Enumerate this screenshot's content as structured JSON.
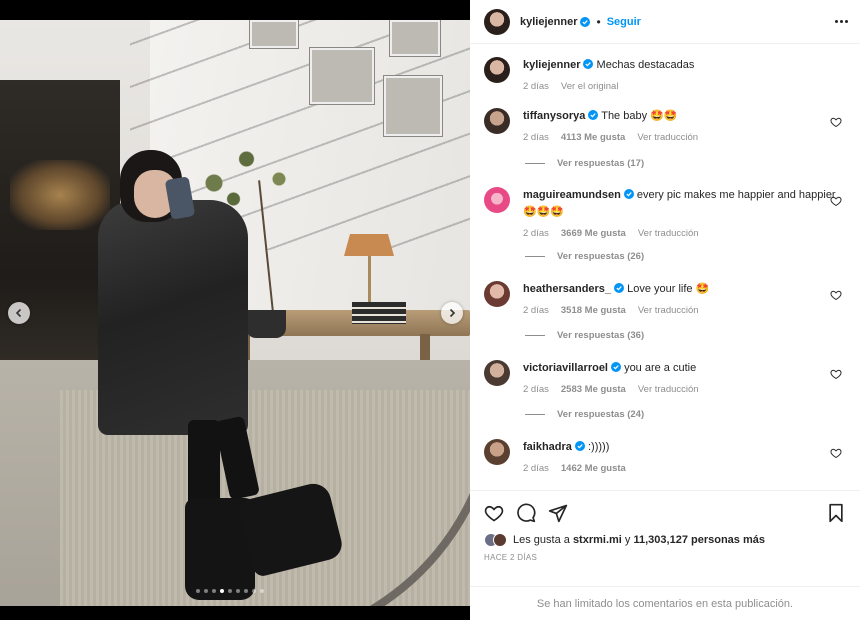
{
  "post": {
    "author": "kyliejenner",
    "follow_sep": "•",
    "follow_label": "Seguir",
    "caption": "Mechas destacadas",
    "caption_time": "2 días",
    "see_original": "Ver el original"
  },
  "carousel": {
    "total_slides": 9,
    "active_index": 3
  },
  "comments": [
    {
      "user": "tiffanysorya",
      "text": "The baby 🤩🤩",
      "time": "2 días",
      "likes": "4113 Me gusta",
      "translate": "Ver traducción",
      "replies": "Ver respuestas (17)"
    },
    {
      "user": "maguireamundsen",
      "text": "every pic makes me happier and happier",
      "text2": "🤩🤩🤩",
      "time": "2 días",
      "likes": "3669 Me gusta",
      "translate": "Ver traducción",
      "replies": "Ver respuestas (26)"
    },
    {
      "user": "heathersanders_",
      "text": "Love your life 🤩",
      "time": "2 días",
      "likes": "3518 Me gusta",
      "translate": "Ver traducción",
      "replies": "Ver respuestas (36)"
    },
    {
      "user": "victoriavillarroel",
      "text": "you are a cutie",
      "time": "2 días",
      "likes": "2583 Me gusta",
      "translate": "Ver traducción",
      "replies": "Ver respuestas (24)"
    },
    {
      "user": "faikhadra",
      "text": ":)))))",
      "time": "2 días",
      "likes": "1462 Me gusta"
    }
  ],
  "likes_bar": {
    "prefix": "Les gusta a",
    "user": "stxrmi.mi",
    "connector": "y",
    "count": "11,303,127 personas más"
  },
  "post_time": "HACE 2 DÍAS",
  "comments_limited": "Se han limitado los comentarios en esta publicación.",
  "colors": {
    "accent": "#0095f6",
    "muted": "#8e8e8e",
    "text": "#262626"
  }
}
